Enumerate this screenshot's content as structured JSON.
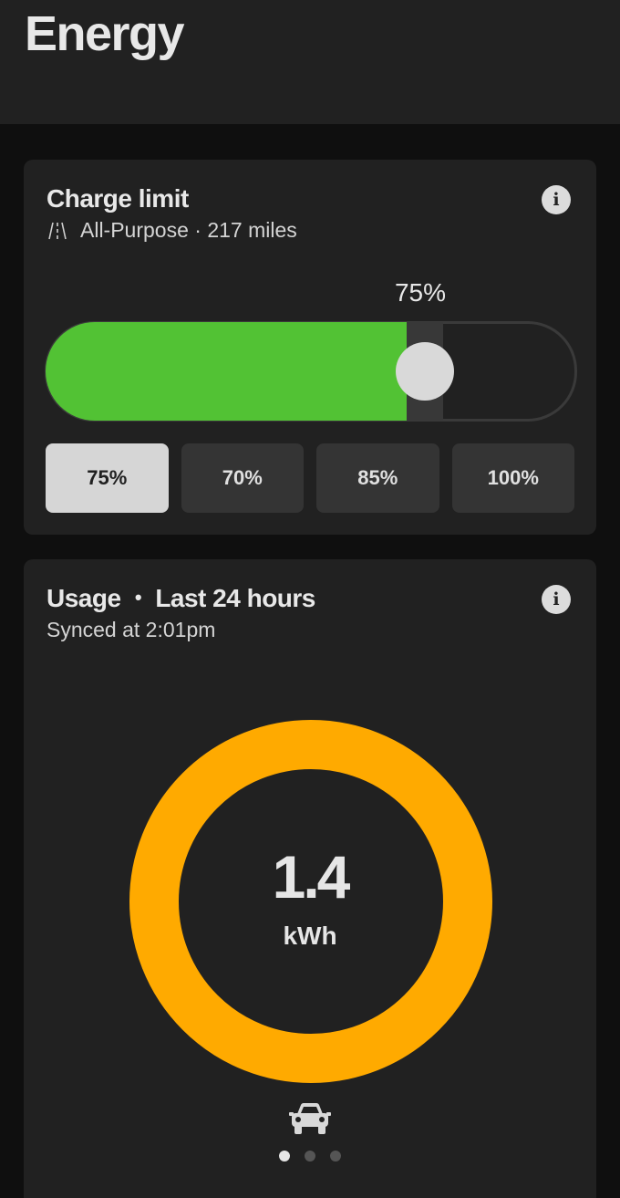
{
  "header": {
    "title": "Energy"
  },
  "charge_limit": {
    "title": "Charge limit",
    "mode": "All-Purpose",
    "range": "217 miles",
    "subtitle": "All-Purpose · 217 miles",
    "current_percent_label": "75%",
    "current_fraction": 0.75,
    "fill_color": "#52c234",
    "presets": [
      {
        "label": "75%",
        "selected": true
      },
      {
        "label": "70%",
        "selected": false
      },
      {
        "label": "85%",
        "selected": false
      },
      {
        "label": "100%",
        "selected": false
      }
    ],
    "info_icon": "info-icon",
    "mode_icon": "road-icon"
  },
  "usage": {
    "title": "Usage",
    "separator": "•",
    "period": "Last 24 hours",
    "synced": "Synced at 2:01pm",
    "total_value": "1.4",
    "total_unit": "kWh",
    "ring_color": "#ffaa00",
    "breakdown_icon": "car-icon",
    "pages": 3,
    "active_page": 0,
    "info_icon": "info-icon"
  }
}
